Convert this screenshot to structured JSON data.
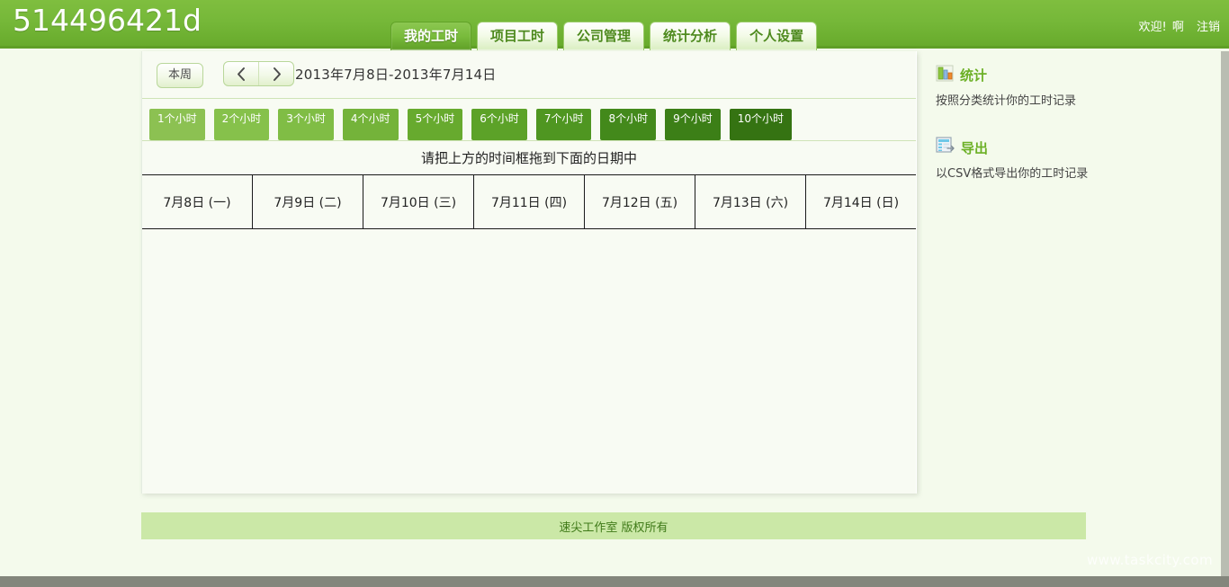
{
  "header": {
    "brand": "514496421d",
    "tabs": [
      {
        "label": "我的工时",
        "active": true
      },
      {
        "label": "项目工时",
        "active": false
      },
      {
        "label": "公司管理",
        "active": false
      },
      {
        "label": "统计分析",
        "active": false
      },
      {
        "label": "个人设置",
        "active": false
      }
    ],
    "welcome": "欢迎!",
    "username": "啊",
    "logout": "注销",
    "bg_color": "#76b839"
  },
  "date_bar": {
    "this_week": "本周",
    "prev_icon": "chevron-left-icon",
    "next_icon": "chevron-right-icon",
    "range": "2013年7月8日-2013年7月14日"
  },
  "chips": [
    {
      "label": "1个小时",
      "color": "#8cc152"
    },
    {
      "label": "2个小时",
      "color": "#86c14b"
    },
    {
      "label": "3个小时",
      "color": "#80bd45"
    },
    {
      "label": "4个小时",
      "color": "#74b33a"
    },
    {
      "label": "5个小时",
      "color": "#67aa2e"
    },
    {
      "label": "6个小时",
      "color": "#5ca228"
    },
    {
      "label": "7个小时",
      "color": "#4f9621"
    },
    {
      "label": "8个小时",
      "color": "#43891b"
    },
    {
      "label": "9个小时",
      "color": "#3c7f17"
    },
    {
      "label": "10个小时",
      "color": "#357312"
    }
  ],
  "hint": "请把上方的时间框拖到下面的日期中",
  "days": [
    {
      "label": "7月8日 (一)"
    },
    {
      "label": "7月9日 (二)"
    },
    {
      "label": "7月10日 (三)"
    },
    {
      "label": "7月11日 (四)"
    },
    {
      "label": "7月12日 (五)"
    },
    {
      "label": "7月13日 (六)"
    },
    {
      "label": "7月14日 (日)"
    }
  ],
  "sidebar": {
    "blocks": [
      {
        "icon": "bar-chart-icon",
        "title": "统计",
        "desc": "按照分类统计你的工时记录"
      },
      {
        "icon": "export-document-icon",
        "title": "导出",
        "desc": "以CSV格式导出你的工时记录"
      }
    ]
  },
  "footer": {
    "text": "速尖工作室 版权所有"
  },
  "watermark": "www.taskcity.com"
}
